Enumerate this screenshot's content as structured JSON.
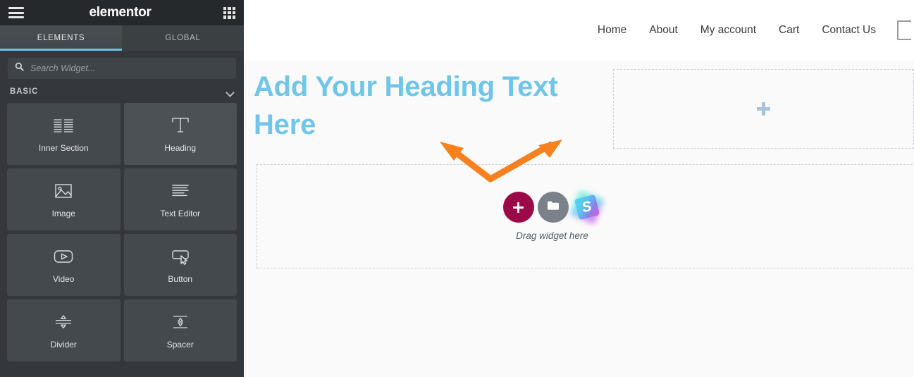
{
  "panel": {
    "logo": "elementor",
    "menu_icon": "hamburger-icon",
    "apps_icon": "grid-apps-icon",
    "tabs": [
      {
        "label": "ELEMENTS",
        "active": true
      },
      {
        "label": "GLOBAL",
        "active": false
      }
    ],
    "search": {
      "placeholder": "Search Widget...",
      "value": "",
      "icon": "search-icon"
    },
    "category": {
      "title": "BASIC",
      "collapse_icon": "chevron-down-icon",
      "expanded": true
    },
    "widgets": [
      {
        "label": "Inner Section",
        "icon": "inner-section-icon",
        "highlighted": false
      },
      {
        "label": "Heading",
        "icon": "heading-T-icon",
        "highlighted": true
      },
      {
        "label": "Image",
        "icon": "image-icon",
        "highlighted": false
      },
      {
        "label": "Text Editor",
        "icon": "text-editor-icon",
        "highlighted": false
      },
      {
        "label": "Video",
        "icon": "video-play-icon",
        "highlighted": false
      },
      {
        "label": "Button",
        "icon": "button-cursor-icon",
        "highlighted": false
      },
      {
        "label": "Divider",
        "icon": "divider-icon",
        "highlighted": false
      },
      {
        "label": "Spacer",
        "icon": "spacer-icon",
        "highlighted": false
      }
    ],
    "collapse_tab_icon": "chevron-left-icon"
  },
  "canvas": {
    "site_nav": [
      {
        "label": "Home"
      },
      {
        "label": "About"
      },
      {
        "label": "My account"
      },
      {
        "label": "Cart"
      },
      {
        "label": "Contact Us"
      }
    ],
    "nav_cutoff_icon": "cut-off-bracket-icon",
    "heading": "Add Your Heading Text Here",
    "heading_color": "#71c5e8",
    "empty_column": {
      "add_icon": "plus-icon"
    },
    "drop_zone": {
      "label": "Drag widget here",
      "buttons": [
        {
          "name": "add-section-button",
          "icon": "plus-icon",
          "color": "#9b0a46"
        },
        {
          "name": "template-library-button",
          "icon": "folder-icon",
          "color": "#7a8189"
        },
        {
          "name": "stackable-button",
          "icon": "s-badge-icon",
          "color": "#56d4f0"
        }
      ]
    }
  },
  "annotation": {
    "arrow": "double-headed-orange-arrow",
    "color": "#f7811e"
  }
}
